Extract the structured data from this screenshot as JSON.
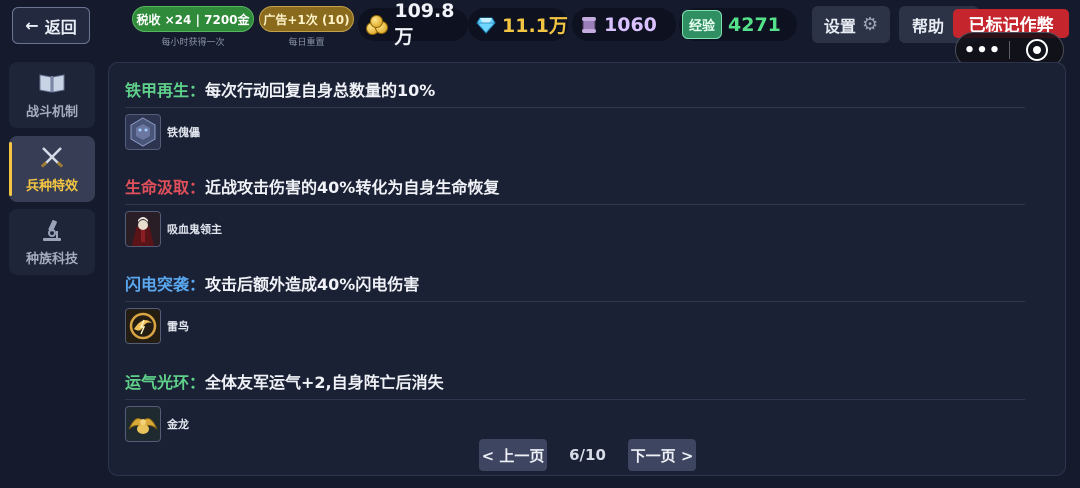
{
  "header": {
    "back_label": "返回",
    "tax_label": "税收 ×24 | 7200金",
    "tax_sub": "每小时获得一次",
    "ad_label": "广告+1次 (10)",
    "ad_sub": "每日重置",
    "gold_value": "109.8万",
    "gem_value": "11.1万",
    "scroll_value": "1060",
    "exp_label": "经验",
    "exp_value": "4271",
    "settings_label": "设置",
    "help_label": "帮助",
    "cheat_label": "已标记作弊"
  },
  "capsule": {
    "more_label": "•••"
  },
  "sidebar": {
    "tabs": [
      {
        "label": "战斗机制"
      },
      {
        "label": "兵种特效"
      },
      {
        "label": "种族科技"
      }
    ],
    "active": "兵种特效"
  },
  "effects": [
    {
      "name": "铁甲再生：",
      "name_color": "#5fd18a",
      "description": "每次行动回复自身总数量的10%",
      "unit": "铁傀儡",
      "icon": "iron-golem-icon"
    },
    {
      "name": "生命汲取：",
      "name_color": "#e0505a",
      "description": "近战攻击伤害的40%转化为自身生命恢复",
      "unit": "吸血鬼领主",
      "icon": "vampire-lord-icon"
    },
    {
      "name": "闪电突袭：",
      "name_color": "#5aa8f0",
      "description": "攻击后额外造成40%闪电伤害",
      "unit": "雷鸟",
      "icon": "thunderbird-icon"
    },
    {
      "name": "运气光环：",
      "name_color": "#5fd18a",
      "description": "全体友军运气+2,自身阵亡后消失",
      "unit": "金龙",
      "icon": "gold-dragon-icon"
    }
  ],
  "pagination": {
    "prev_label": "< 上一页",
    "page_text": "6/10",
    "next_label": "下一页 >",
    "current": 6,
    "total": 10
  }
}
